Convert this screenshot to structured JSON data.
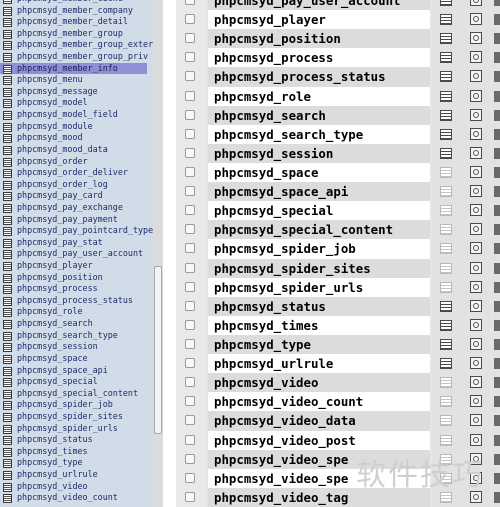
{
  "sidebar": {
    "items": [
      "phpcmsyd_member_cache",
      "phpcmsyd_member_company",
      "phpcmsyd_member_detail",
      "phpcmsyd_member_group",
      "phpcmsyd_member_group_exter",
      "phpcmsyd_member_group_priv",
      "phpcmsyd_member_info",
      "phpcmsyd_menu",
      "phpcmsyd_message",
      "phpcmsyd_model",
      "phpcmsyd_model_field",
      "phpcmsyd_module",
      "phpcmsyd_mood",
      "phpcmsyd_mood_data",
      "phpcmsyd_order",
      "phpcmsyd_order_deliver",
      "phpcmsyd_order_log",
      "phpcmsyd_pay_card",
      "phpcmsyd_pay_exchange",
      "phpcmsyd_pay_payment",
      "phpcmsyd_pay_pointcard_type",
      "phpcmsyd_pay_stat",
      "phpcmsyd_pay_user_account",
      "phpcmsyd_player",
      "phpcmsyd_position",
      "phpcmsyd_process",
      "phpcmsyd_process_status",
      "phpcmsyd_role",
      "phpcmsyd_search",
      "phpcmsyd_search_type",
      "phpcmsyd_session",
      "phpcmsyd_space",
      "phpcmsyd_space_api",
      "phpcmsyd_special",
      "phpcmsyd_special_content",
      "phpcmsyd_spider_job",
      "phpcmsyd_spider_sites",
      "phpcmsyd_spider_urls",
      "phpcmsyd_status",
      "phpcmsyd_times",
      "phpcmsyd_type",
      "phpcmsyd_urlrule",
      "phpcmsyd_video",
      "phpcmsyd_video_count"
    ],
    "selected_index": 6
  },
  "table": {
    "rows": [
      {
        "name": "phpcmsyd_pay_user_account",
        "browse_active": true
      },
      {
        "name": "phpcmsyd_player",
        "browse_active": true
      },
      {
        "name": "phpcmsyd_position",
        "browse_active": true
      },
      {
        "name": "phpcmsyd_process",
        "browse_active": true
      },
      {
        "name": "phpcmsyd_process_status",
        "browse_active": true
      },
      {
        "name": "phpcmsyd_role",
        "browse_active": true
      },
      {
        "name": "phpcmsyd_search",
        "browse_active": true
      },
      {
        "name": "phpcmsyd_search_type",
        "browse_active": true
      },
      {
        "name": "phpcmsyd_session",
        "browse_active": true
      },
      {
        "name": "phpcmsyd_space",
        "browse_active": false
      },
      {
        "name": "phpcmsyd_space_api",
        "browse_active": false
      },
      {
        "name": "phpcmsyd_special",
        "browse_active": false
      },
      {
        "name": "phpcmsyd_special_content",
        "browse_active": false
      },
      {
        "name": "phpcmsyd_spider_job",
        "browse_active": false
      },
      {
        "name": "phpcmsyd_spider_sites",
        "browse_active": false
      },
      {
        "name": "phpcmsyd_spider_urls",
        "browse_active": false
      },
      {
        "name": "phpcmsyd_status",
        "browse_active": true
      },
      {
        "name": "phpcmsyd_times",
        "browse_active": true
      },
      {
        "name": "phpcmsyd_type",
        "browse_active": true
      },
      {
        "name": "phpcmsyd_urlrule",
        "browse_active": true
      },
      {
        "name": "phpcmsyd_video",
        "browse_active": false
      },
      {
        "name": "phpcmsyd_video_count",
        "browse_active": false
      },
      {
        "name": "phpcmsyd_video_data",
        "browse_active": false
      },
      {
        "name": "phpcmsyd_video_post",
        "browse_active": false
      },
      {
        "name": "phpcmsyd_video_spe",
        "browse_active": false
      },
      {
        "name": "phpcmsyd_video_spe",
        "browse_active": false
      },
      {
        "name": "phpcmsyd_video_tag",
        "browse_active": false
      }
    ]
  },
  "watermark": "软件技巧",
  "colors": {
    "sidebar_bg": "#d0dce8",
    "sidebar_text": "#1e2c6a",
    "selected_bg": "#8f8fd6",
    "row_odd": "#dcdcdc",
    "row_even": "#ffffff"
  }
}
